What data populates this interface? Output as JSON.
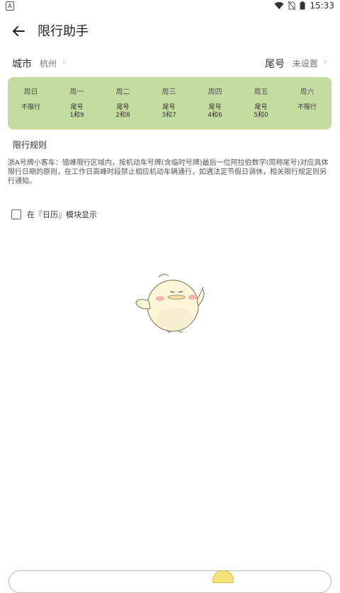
{
  "status_bar": {
    "left_icon_label": "A",
    "time": "15:33",
    "icons": [
      "wifi-icon",
      "no-sim-icon",
      "battery-icon"
    ]
  },
  "app_bar": {
    "title": "限行助手",
    "back_icon": "arrow-left-icon"
  },
  "selectors": {
    "city_label": "城市",
    "city_value": "杭州",
    "tail_label": "尾号",
    "tail_value": "未设置",
    "chevron": "›"
  },
  "week": {
    "days": [
      {
        "name": "周日",
        "rule": "不限行"
      },
      {
        "name": "周一",
        "rule": "尾号\n1和9"
      },
      {
        "name": "周二",
        "rule": "尾号\n2和8"
      },
      {
        "name": "周三",
        "rule": "尾号\n3和7"
      },
      {
        "name": "周四",
        "rule": "尾号\n4和6"
      },
      {
        "name": "周五",
        "rule": "尾号\n5和0"
      },
      {
        "name": "周六",
        "rule": "不限行"
      }
    ],
    "background": "#c3dda0"
  },
  "rules": {
    "title": "限行规则",
    "text": "浙A号牌小客车：错峰限行区域内，按机动车号牌(含临时号牌)最后一位阿拉伯数字(简称尾号)对应具体限行日期的原则，在工作日高峰时段禁止相应机动车辆通行，如遇法定节假日调休，相关限行规定则另行通知。"
  },
  "calendar_option": {
    "label": "在『日历』模块显示",
    "checked": false
  }
}
